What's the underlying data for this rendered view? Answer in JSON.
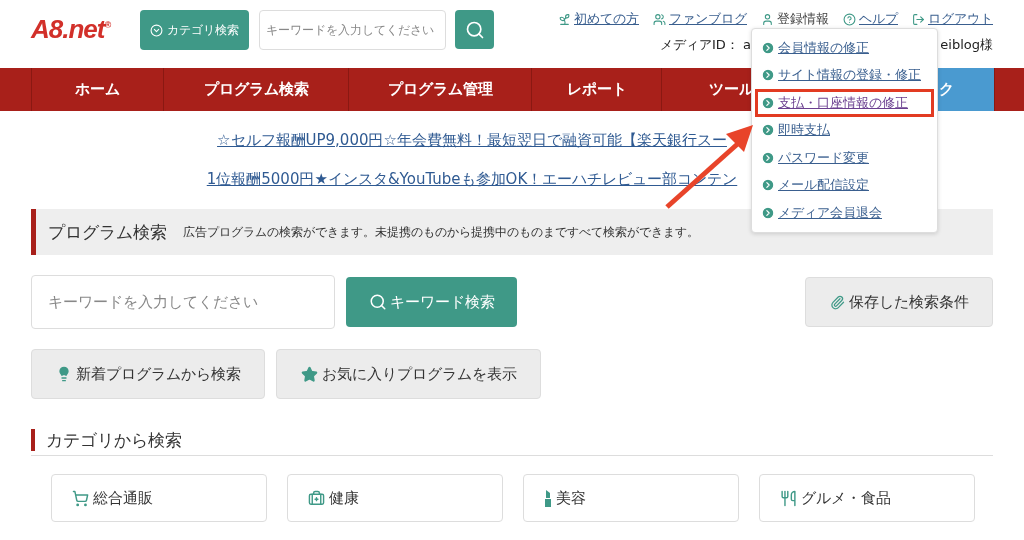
{
  "logo": "A8.net$^{®}$",
  "category_button": "カテゴリ検索",
  "header_search": {
    "placeholder": "キーワードを入力してください"
  },
  "top_links": [
    {
      "label": "初めての方",
      "kind": "link"
    },
    {
      "label": "ファンブログ",
      "kind": "link"
    },
    {
      "label": "登録情報",
      "kind": "menu"
    },
    {
      "label": "ヘルプ",
      "kind": "link"
    },
    {
      "label": "ログアウト",
      "kind": "link"
    }
  ],
  "media_id": {
    "start": "メディアID： a",
    "end": "eiblog様"
  },
  "nav": [
    {
      "label": "ホーム",
      "selected": false
    },
    {
      "label": "プログラム検索",
      "selected": false
    },
    {
      "label": "プログラム管理",
      "selected": false
    },
    {
      "label": "レポート",
      "selected": false
    },
    {
      "label": "ツール",
      "selected": false
    },
    {
      "label": "ク",
      "selected": true
    }
  ],
  "account_menu": [
    {
      "label": "会員情報の修正",
      "highlighted": false
    },
    {
      "label": "サイト情報の登録・修正",
      "highlighted": false
    },
    {
      "label": "支払・口座情報の修正",
      "highlighted": true
    },
    {
      "label": "即時支払",
      "highlighted": false
    },
    {
      "label": "パスワード変更",
      "highlighted": false
    },
    {
      "label": "メール配信設定",
      "highlighted": false
    },
    {
      "label": "メディア会員退会",
      "highlighted": false
    }
  ],
  "notices": [
    "☆セルフ報酬UP9,000円☆年会費無料！最短翌日で融資可能【楽天銀行スー",
    "1位報酬5000円★インスタ&YouTubeも参加OK！エーハチレビュー部コンテン"
  ],
  "program_search": {
    "title": "プログラム検索",
    "description": "広告プログラムの検索ができます。未提携のものから提携中のものまですべて検索ができます。",
    "keyword": {
      "placeholder": "キーワードを入力してください"
    },
    "search_button": "キーワード検索",
    "saved_button": "保存した検索条件",
    "new_button": "新着プログラムから検索",
    "favorites_button": "お気に入りプログラムを表示"
  },
  "category_search": {
    "title": "カテゴリから検索",
    "categories": [
      "総合通販",
      "健康",
      "美容",
      "グルメ・食品"
    ]
  }
}
